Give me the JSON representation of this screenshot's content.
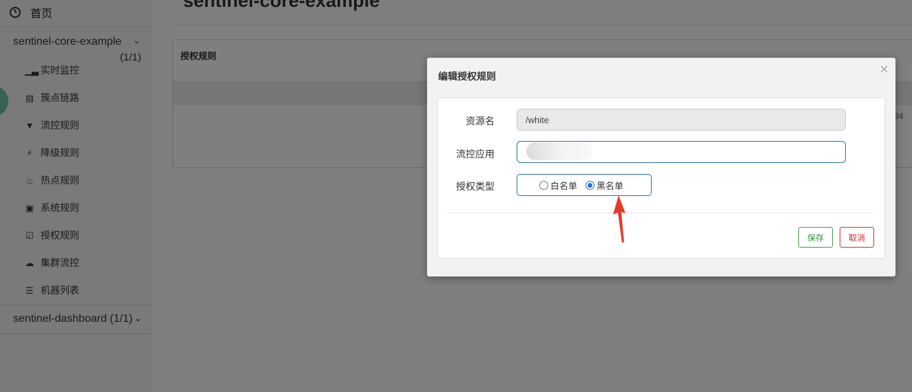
{
  "sidebar": {
    "home_label": "首页",
    "apps": [
      {
        "name": "sentinel-core-example",
        "count": "(1/1)"
      },
      {
        "name": "sentinel-dashboard (1/1)"
      }
    ],
    "menu": [
      {
        "label": "实时监控",
        "icon": "bar-chart-icon"
      },
      {
        "label": "簇点链路",
        "icon": "list-icon"
      },
      {
        "label": "流控规则",
        "icon": "filter-icon"
      },
      {
        "label": "降级规则",
        "icon": "bolt-icon"
      },
      {
        "label": "热点规则",
        "icon": "fire-icon"
      },
      {
        "label": "系统规则",
        "icon": "lock-icon"
      },
      {
        "label": "授权规则",
        "icon": "check-square-icon"
      },
      {
        "label": "集群流控",
        "icon": "cloud-icon"
      },
      {
        "label": "机器列表",
        "icon": "th-list-icon"
      }
    ]
  },
  "main": {
    "title": "sentinel-core-example",
    "panel_title": "授权规则",
    "cell_fragment": "34"
  },
  "modal": {
    "title": "编辑授权规则",
    "close_glyph": "×",
    "fields": {
      "resource_label": "资源名",
      "resource_value": "/white",
      "app_label": "流控应用",
      "app_value": "",
      "strategy_label": "授权类型"
    },
    "strategy_options": [
      {
        "label": "白名单",
        "checked": false
      },
      {
        "label": "黑名单",
        "checked": true
      }
    ],
    "save_label": "保存",
    "cancel_label": "取消"
  },
  "colors": {
    "overlay": "rgba(0,0,0,0.5)",
    "primary_border": "#2a6ea3",
    "save": "#2f8f3e",
    "cancel": "#c9302c",
    "annotation_arrow": "#e8382a"
  }
}
